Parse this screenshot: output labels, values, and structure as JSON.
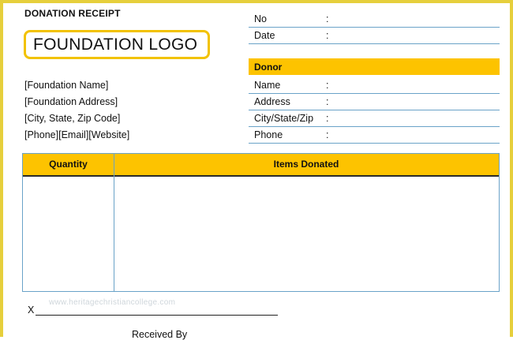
{
  "document": {
    "title": "DONATION RECEIPT",
    "logo_text": "FOUNDATION LOGO",
    "foundation": {
      "name": "[Foundation Name]",
      "address": "[Foundation Address]",
      "city_state_zip": "[City, State, Zip Code]",
      "contact": "[Phone][Email][Website]"
    },
    "receipt_fields": [
      {
        "label": "No",
        "value": ":"
      },
      {
        "label": "Date",
        "value": ":"
      }
    ],
    "donor": {
      "heading": "Donor",
      "fields": [
        {
          "label": "Name",
          "value": ":"
        },
        {
          "label": "Address",
          "value": ":"
        },
        {
          "label": "City/State/Zip",
          "value": ":"
        },
        {
          "label": "Phone",
          "value": ":"
        }
      ]
    },
    "items_table": {
      "headers": [
        "Quantity",
        "Items Donated"
      ]
    },
    "signature": {
      "mark": "X",
      "caption": "Received By"
    },
    "watermark": "www.heritagechristiancollege.com",
    "colors": {
      "accent": "#fdc300",
      "frame": "#e6cf3c",
      "rule": "#6aa3c8"
    }
  }
}
